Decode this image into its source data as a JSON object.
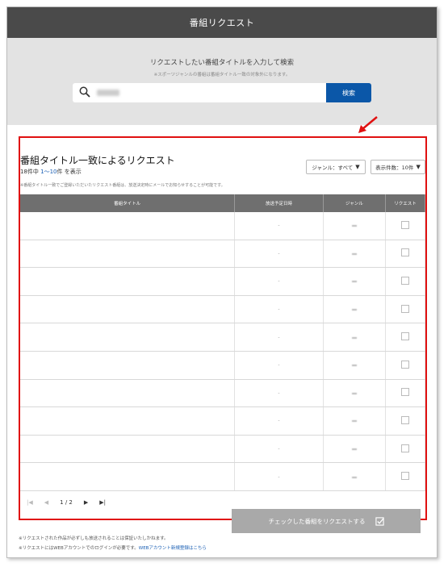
{
  "header": {
    "title": "番組リクエスト"
  },
  "search": {
    "title": "リクエストしたい番組タイトルを入力して検索",
    "note": "※スポーツジャンルの番組は番組タイトル一致の対象外になります。",
    "query": "",
    "button": "検索"
  },
  "results": {
    "title": "番組タイトル一致によるリクエスト",
    "count_prefix": "18件中 ",
    "count_range": "1〜10",
    "count_suffix": "件 を表示",
    "note": "※番組タイトル一致でご登録いただいたリクエスト番組は、放送決定時にメールでお知らせすることが可能です。",
    "genre_filter": "ジャンル：すべて",
    "per_page": "表示件数：10件",
    "columns": [
      "番組タイトル",
      "放送予定日時",
      "ジャンル",
      "リクエスト"
    ],
    "rows": [
      {
        "title": "",
        "date": "-",
        "genre": ""
      },
      {
        "title": "",
        "date": "-",
        "genre": ""
      },
      {
        "title": "",
        "date": "-",
        "genre": ""
      },
      {
        "title": "",
        "date": "-",
        "genre": ""
      },
      {
        "title": "",
        "date": "-",
        "genre": ""
      },
      {
        "title": "",
        "date": "-",
        "genre": ""
      },
      {
        "title": "",
        "date": "-",
        "genre": ""
      },
      {
        "title": "",
        "date": "-",
        "genre": ""
      },
      {
        "title": "",
        "date": "-",
        "genre": ""
      },
      {
        "title": "",
        "date": "-",
        "genre": ""
      }
    ]
  },
  "pager": {
    "page": "1 / 2"
  },
  "submit": {
    "label": "チェックした番組をリクエストする"
  },
  "footer": {
    "note1": "※リクエストされた作品が必ずしも放送されることは保証いたしかねます。",
    "note2": "※リクエストにはWEBアカウントでのログインが必要です。",
    "link": "WEBアカウント新規登録はこちら"
  },
  "colors": {
    "header_bg": "#4a4a4a",
    "button_blue": "#0b57a8",
    "highlight_red": "#e01010"
  }
}
